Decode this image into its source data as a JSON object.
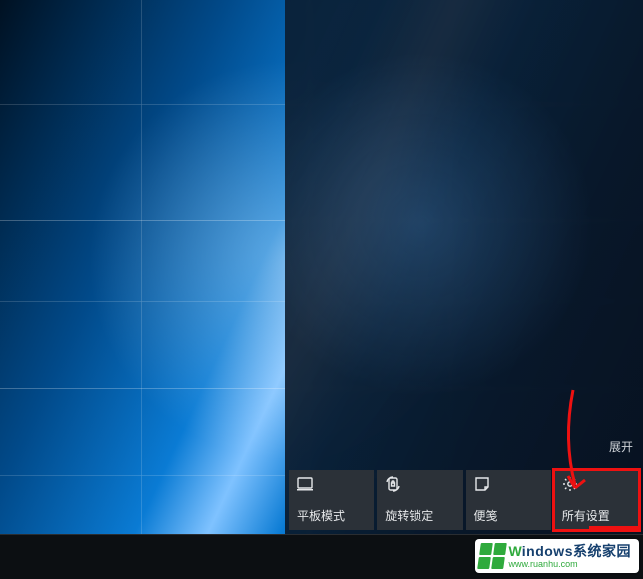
{
  "action_center": {
    "expand_label": "展开",
    "tiles": [
      {
        "icon": "tablet-mode-icon",
        "label": "平板模式"
      },
      {
        "icon": "rotation-lock-icon",
        "label": "旋转锁定"
      },
      {
        "icon": "note-icon",
        "label": "便笺"
      },
      {
        "icon": "settings-gear-icon",
        "label": "所有设置"
      }
    ],
    "highlighted_tile_index": 3
  },
  "taskbar": {
    "tray": [
      {
        "icon": "chevron-up-icon",
        "name": "show-hidden-icons"
      },
      {
        "icon": "devices-icon",
        "name": "tray-devices"
      },
      {
        "icon": "volume-icon",
        "name": "tray-volume"
      }
    ]
  },
  "watermark": {
    "brand_initial": "W",
    "brand_rest": "indows系统家园",
    "url": "www.ruanhu.com"
  },
  "annotation": {
    "arrow_color": "#e11"
  }
}
